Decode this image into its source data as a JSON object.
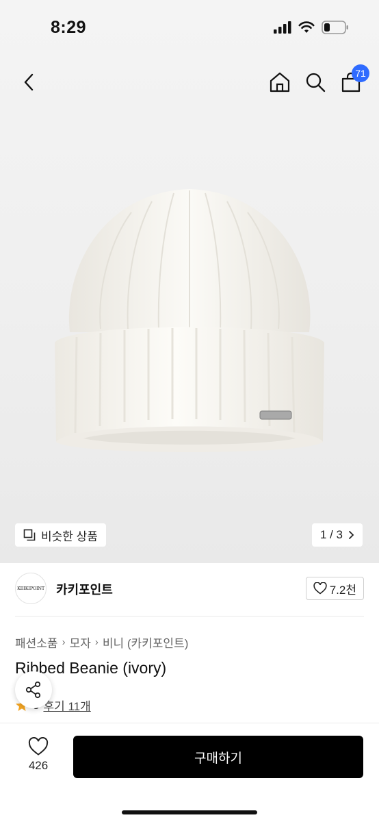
{
  "status": {
    "time": "8:29"
  },
  "nav": {
    "cart_count": "71"
  },
  "image": {
    "similar_label": "비슷한 상품",
    "page_indicator": "1 / 3"
  },
  "store": {
    "logo_text": "KIIIKIPOINT",
    "name": "카키포인트",
    "likes": "7.2천"
  },
  "breadcrumb": [
    "패션소품",
    "모자",
    "비니 (카키포인트)"
  ],
  "product": {
    "title": "Ribbed Beanie (ivory)",
    "rating": "5",
    "reviews": "후기 11개"
  },
  "bottom": {
    "wish_count": "426",
    "buy_label": "구매하기"
  },
  "colors": {
    "accent_badge": "#2f6bff",
    "buy_button": "#000000",
    "star": "#f5a623"
  }
}
